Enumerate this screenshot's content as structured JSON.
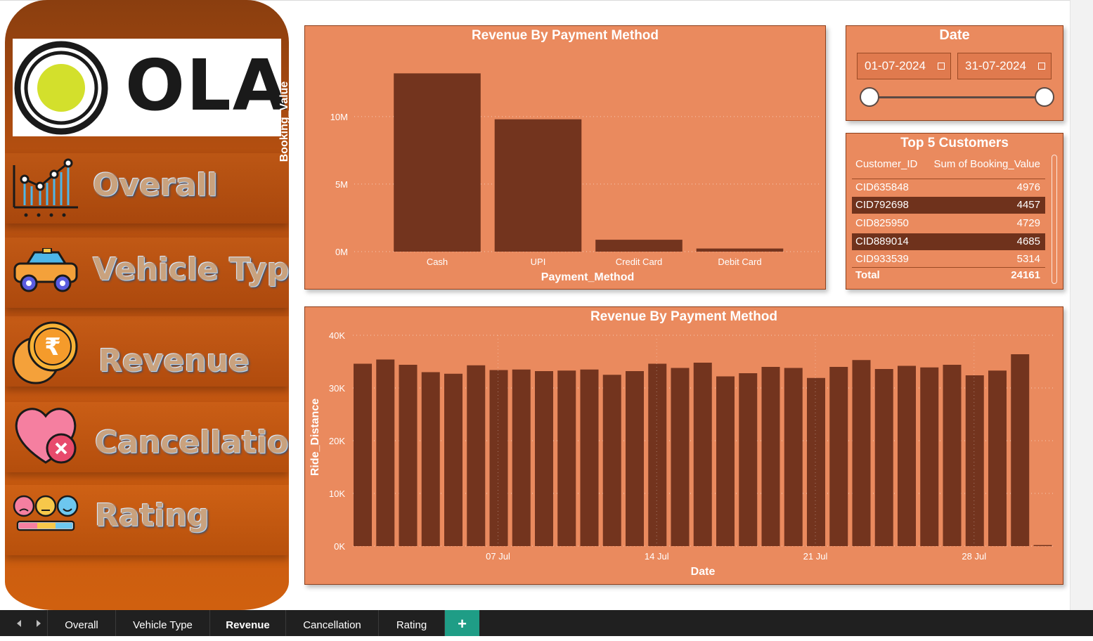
{
  "sidebar": {
    "logo_text": "OLA",
    "items": [
      {
        "label": "Overall",
        "icon": "line-chart-icon"
      },
      {
        "label": "Vehicle Type",
        "icon": "car-icon"
      },
      {
        "label": "Revenue",
        "icon": "rupee-coin-icon"
      },
      {
        "label": "Cancellation",
        "icon": "heart-cancel-icon"
      },
      {
        "label": "Rating",
        "icon": "rating-faces-icon"
      }
    ]
  },
  "colors": {
    "panel_bg": "#ea8a5e",
    "bar": "#73341e",
    "sidebar": "#c25612",
    "tab_add": "#1f9d86"
  },
  "revenue_chart": {
    "title": "Revenue By Payment Method",
    "xlabel": "Payment_Method",
    "ylabel": "Booking_Value",
    "yticks": [
      "0M",
      "5M",
      "10M"
    ]
  },
  "distance_chart": {
    "title": "Revenue By Payment Method",
    "xlabel": "Date",
    "ylabel": "Ride_Distance",
    "yticks": [
      "0K",
      "10K",
      "20K",
      "30K",
      "40K"
    ],
    "xticks": [
      "07 Jul",
      "14 Jul",
      "21 Jul",
      "28 Jul"
    ]
  },
  "chart_data": [
    {
      "type": "bar",
      "title": "Revenue By Payment Method",
      "xlabel": "Payment_Method",
      "ylabel": "Booking_Value",
      "categories": [
        "Cash",
        "UPI",
        "Credit Card",
        "Debit Card"
      ],
      "values": [
        13200000,
        9800000,
        880000,
        230000
      ],
      "ylim": [
        0,
        14000000
      ],
      "grid": true
    },
    {
      "type": "bar",
      "title": "Revenue By Payment Method",
      "xlabel": "Date",
      "ylabel": "Ride_Distance",
      "x": [
        "01 Jul",
        "02 Jul",
        "03 Jul",
        "04 Jul",
        "05 Jul",
        "06 Jul",
        "07 Jul",
        "08 Jul",
        "09 Jul",
        "10 Jul",
        "11 Jul",
        "12 Jul",
        "13 Jul",
        "14 Jul",
        "15 Jul",
        "16 Jul",
        "17 Jul",
        "18 Jul",
        "19 Jul",
        "20 Jul",
        "21 Jul",
        "22 Jul",
        "23 Jul",
        "24 Jul",
        "25 Jul",
        "26 Jul",
        "27 Jul",
        "28 Jul",
        "29 Jul",
        "30 Jul",
        "31 Jul"
      ],
      "values": [
        34600,
        35400,
        34400,
        33000,
        32700,
        34300,
        33400,
        33500,
        33200,
        33300,
        33500,
        32500,
        33200,
        34600,
        33800,
        34800,
        32200,
        32800,
        34000,
        33800,
        31900,
        34000,
        35300,
        33600,
        34200,
        33900,
        34400,
        32400,
        33300,
        36400,
        200
      ],
      "ylim": [
        0,
        40000
      ],
      "grid": true
    }
  ],
  "date_slicer": {
    "title": "Date",
    "start": "01-07-2024",
    "end": "31-07-2024"
  },
  "top_customers": {
    "title": "Top 5 Customers",
    "headers": [
      "Customer_ID",
      "Sum of Booking_Value"
    ],
    "rows": [
      {
        "id": "CID635848",
        "value": "4976"
      },
      {
        "id": "CID792698",
        "value": "4457"
      },
      {
        "id": "CID825950",
        "value": "4729"
      },
      {
        "id": "CID889014",
        "value": "4685"
      },
      {
        "id": "CID933539",
        "value": "5314"
      }
    ],
    "total_label": "Total",
    "total_value": "24161"
  },
  "tabs": [
    {
      "label": "Overall"
    },
    {
      "label": "Vehicle Type"
    },
    {
      "label": "Revenue"
    },
    {
      "label": "Cancellation"
    },
    {
      "label": "Rating"
    }
  ],
  "tab_add_label": "+"
}
